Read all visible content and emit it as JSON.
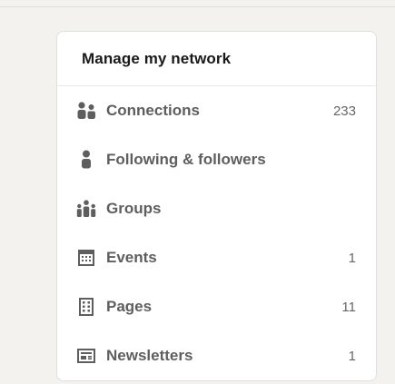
{
  "network_panel": {
    "title": "Manage my network",
    "items": [
      {
        "label": "Connections",
        "count": "233",
        "icon": "people-icon"
      },
      {
        "label": "Following & followers",
        "count": "",
        "icon": "person-icon"
      },
      {
        "label": "Groups",
        "count": "",
        "icon": "group-icon"
      },
      {
        "label": "Events",
        "count": "1",
        "icon": "calendar-icon"
      },
      {
        "label": "Pages",
        "count": "11",
        "icon": "building-icon"
      },
      {
        "label": "Newsletters",
        "count": "1",
        "icon": "newspaper-icon"
      }
    ]
  },
  "colors": {
    "background": "#f4f2ee",
    "card": "#ffffff",
    "text_primary": "#191919",
    "text_secondary": "#5e5e5e"
  }
}
